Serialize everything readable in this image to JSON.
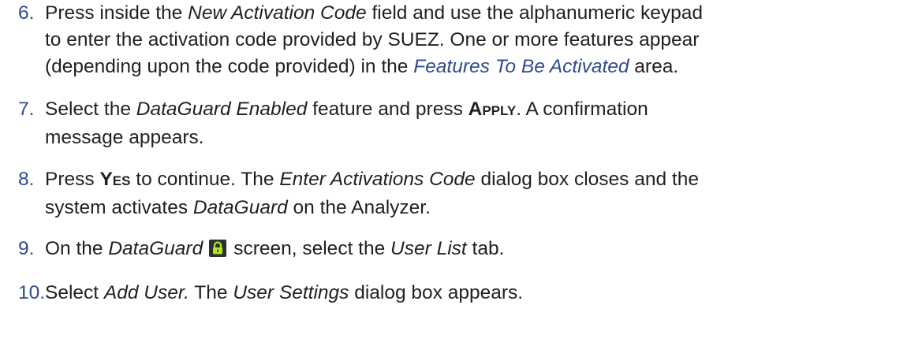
{
  "steps": [
    {
      "number": "6.",
      "line1": {
        "a": "Press inside the ",
        "b": "New Activation Code",
        "c": " field and use the alphanumeric keypad"
      },
      "line2": "to enter the activation code provided by SUEZ. One or more features appear",
      "line3": {
        "a": "(depending upon the code provided) in the ",
        "b": "Features To Be Activated",
        "c": " area."
      }
    },
    {
      "number": "7.",
      "line1": {
        "a": "Select the ",
        "b": "DataGuard Enabled",
        "c": " feature and press ",
        "d_first": "A",
        "d_rest": "PPLY",
        "e": ". A confirmation"
      },
      "line2": "message appears."
    },
    {
      "number": "8.",
      "line1": {
        "a": "Press ",
        "b_first": "Y",
        "b_rest": "ES",
        "c": " to continue. The ",
        "d": "Enter Activations Code",
        "e": " dialog box closes and the"
      },
      "line2": {
        "a": "system activates ",
        "b": "DataGuard",
        "c": " on the Analyzer."
      }
    },
    {
      "number": "9.",
      "line1": {
        "a": "On the ",
        "b": "DataGuard",
        "icon": "lock-icon",
        "c": "screen, select the ",
        "d": "User List",
        "e": " tab."
      }
    },
    {
      "number": "10.",
      "line1": {
        "a": "Select ",
        "b": "Add User.",
        "c": " The ",
        "d": "User Settings",
        "e": " dialog box appears."
      }
    }
  ],
  "colors": {
    "text": "#231f20",
    "step_number": "#2e4a8f",
    "highlight": "#2e4a8f",
    "lock_bg": "#2c2f33",
    "lock_fg": "#b5e61d"
  }
}
